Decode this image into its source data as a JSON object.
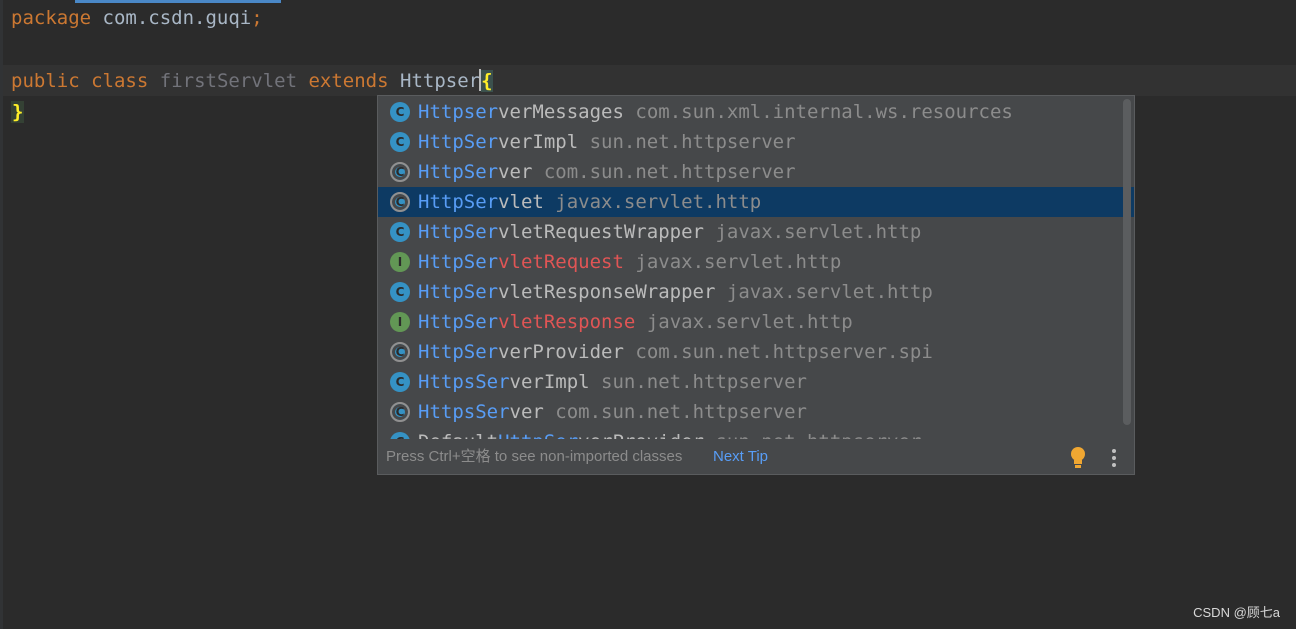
{
  "editor": {
    "line1": {
      "keyword": "package",
      "package_name": "com.csdn.guqi",
      "semicolon": ";"
    },
    "line3": {
      "kw_public": "public",
      "kw_class": "class",
      "class_name": "firstServlet",
      "kw_extends": "extends",
      "typed": "Httpser",
      "open_brace": "{"
    },
    "line4": {
      "close_brace": "}"
    }
  },
  "completion": {
    "items": [
      {
        "icon": "class-icon",
        "icon_glyph": "C",
        "match": "Httpser",
        "rest": "verMessages",
        "package": "com.sun.xml.internal.ws.resources",
        "selected": false
      },
      {
        "icon": "class-icon",
        "icon_glyph": "C",
        "match": "HttpSer",
        "rest": "verImpl",
        "package": "sun.net.httpserver",
        "selected": false
      },
      {
        "icon": "abstract-class-icon",
        "icon_glyph": "C",
        "match": "HttpSer",
        "rest": "ver",
        "package": "com.sun.net.httpserver",
        "selected": false
      },
      {
        "icon": "abstract-class-icon",
        "icon_glyph": "C",
        "match": "HttpSer",
        "rest": "vlet",
        "package": "javax.servlet.http",
        "selected": true
      },
      {
        "icon": "class-icon",
        "icon_glyph": "C",
        "match": "HttpSer",
        "rest": "vletRequestWrapper",
        "package": "javax.servlet.http",
        "selected": false
      },
      {
        "icon": "interface-icon",
        "icon_glyph": "I",
        "match": "HttpSer",
        "rest": "vletRequest",
        "package": "javax.servlet.http",
        "selected": false
      },
      {
        "icon": "class-icon",
        "icon_glyph": "C",
        "match": "HttpSer",
        "rest": "vletResponseWrapper",
        "package": "javax.servlet.http",
        "selected": false
      },
      {
        "icon": "interface-icon",
        "icon_glyph": "I",
        "match": "HttpSer",
        "rest": "vletResponse",
        "package": "javax.servlet.http",
        "selected": false
      },
      {
        "icon": "abstract-class-icon",
        "icon_glyph": "C",
        "match": "HttpSer",
        "rest": "verProvider",
        "package": "com.sun.net.httpserver.spi",
        "selected": false
      },
      {
        "icon": "class-icon",
        "icon_glyph": "C",
        "match": "HttpsSer",
        "rest": "verImpl",
        "package": "sun.net.httpserver",
        "selected": false
      },
      {
        "icon": "abstract-class-icon",
        "icon_glyph": "C",
        "match": "HttpsSer",
        "rest": "ver",
        "package": "com.sun.net.httpserver",
        "selected": false
      },
      {
        "icon": "class-icon",
        "icon_glyph": "C",
        "prefix": "Default",
        "match": "HttpSer",
        "rest": "verProvider",
        "package": "sun.net.httpserver",
        "selected": false
      }
    ],
    "footer_hint": "Press Ctrl+空格 to see non-imported classes",
    "footer_link": "Next Tip"
  },
  "colors": {
    "match": "#589df6",
    "selected_bg": "#0d3a63",
    "keyword": "#cc7832",
    "deprecated": "#e05555"
  },
  "watermark": "CSDN @顾七a"
}
